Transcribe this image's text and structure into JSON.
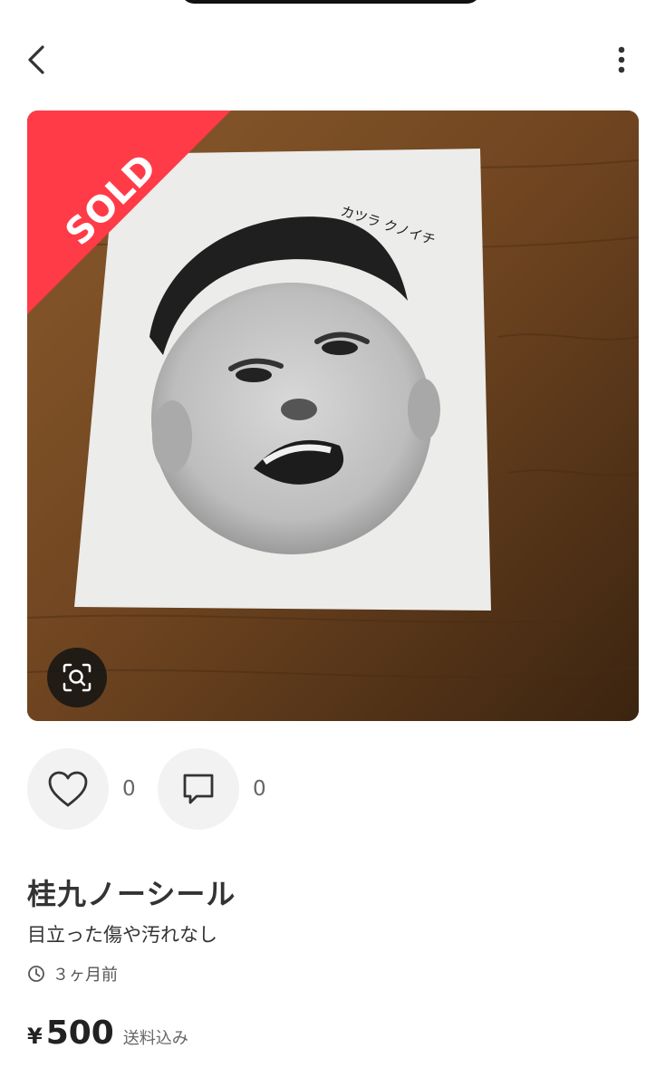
{
  "header": {
    "back_icon": "chevron-left-icon",
    "more_icon": "vertical-dots-icon"
  },
  "product": {
    "sold_badge": "SOLD",
    "sticker_caption": "カツラ クノイチ",
    "title": "桂九ノーシール",
    "description": "目立った傷や汚れなし",
    "posted": "３ヶ月前",
    "currency": "¥",
    "price": "500",
    "shipping": "送料込み"
  },
  "actions": {
    "likes": "0",
    "comments": "0"
  },
  "colors": {
    "sold_ribbon": "#ff3b47",
    "icon_bg": "#f2f2f2"
  }
}
